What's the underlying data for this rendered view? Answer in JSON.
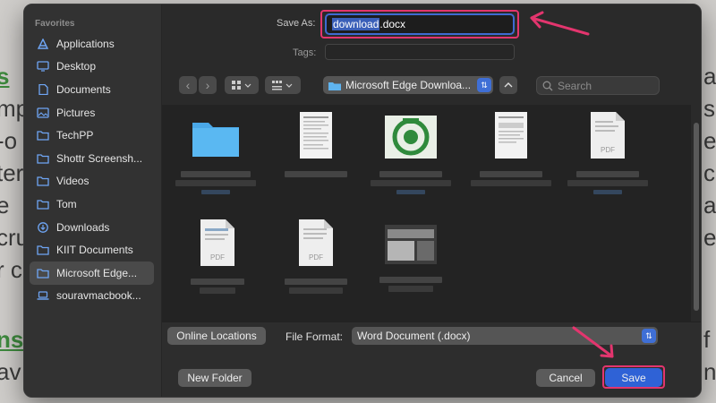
{
  "sidebar": {
    "heading": "Favorites",
    "items": [
      {
        "label": "Applications",
        "icon": "applications-icon"
      },
      {
        "label": "Desktop",
        "icon": "desktop-icon"
      },
      {
        "label": "Documents",
        "icon": "document-icon"
      },
      {
        "label": "Pictures",
        "icon": "pictures-icon"
      },
      {
        "label": "TechPP",
        "icon": "folder-icon"
      },
      {
        "label": "Shottr Screensh...",
        "icon": "folder-icon"
      },
      {
        "label": "Videos",
        "icon": "folder-icon"
      },
      {
        "label": "Tom",
        "icon": "folder-icon"
      },
      {
        "label": "Downloads",
        "icon": "downloads-icon"
      },
      {
        "label": "KIIT Documents",
        "icon": "folder-icon"
      },
      {
        "label": "Microsoft Edge...",
        "icon": "folder-icon"
      },
      {
        "label": "souravmacbook...",
        "icon": "laptop-icon"
      }
    ]
  },
  "save_as": {
    "label": "Save As:",
    "value_name": "download",
    "value_ext": ".docx"
  },
  "tags": {
    "label": "Tags:"
  },
  "toolbar": {
    "back_glyph": "‹",
    "forward_glyph": "›",
    "location": "Microsoft Edge Downloa...",
    "search_placeholder": "Search"
  },
  "files": {
    "items": [
      "folder",
      "document",
      "image",
      "document",
      "pdf",
      "pdf",
      "pdf",
      "image"
    ]
  },
  "bottom": {
    "online_locations": "Online Locations",
    "file_format_label": "File Format:",
    "file_format_value": "Word Document (.docx)",
    "new_folder": "New Folder",
    "cancel": "Cancel",
    "save": "Save"
  },
  "colors": {
    "accent": "#2f62d6",
    "highlight": "#e3356e",
    "folder": "#4aa8e8"
  }
}
